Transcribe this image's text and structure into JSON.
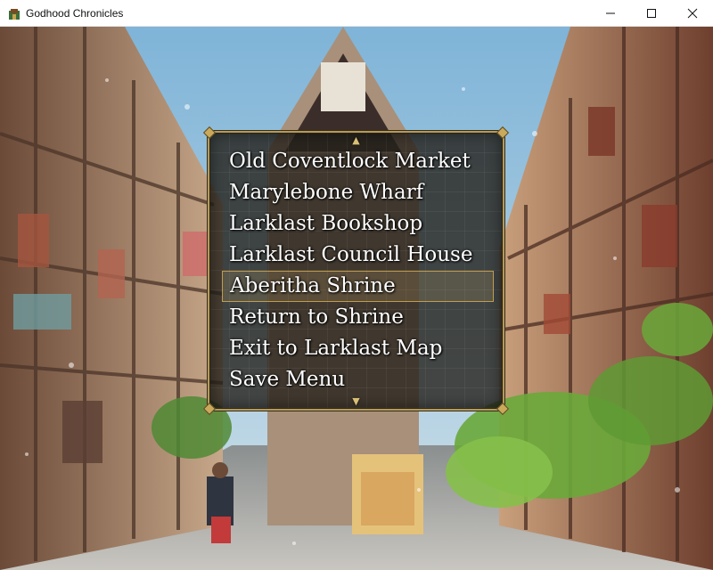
{
  "window": {
    "title": "Godhood Chronicles",
    "minimize_glyph": "—",
    "maximize_glyph": "☐",
    "close_glyph": "✕"
  },
  "menu": {
    "scroll_up_glyph": "▲",
    "scroll_down_glyph": "▼",
    "items": [
      "Old Coventlock Market",
      "Marylebone Wharf",
      "Larklast Bookshop",
      "Larklast Council House",
      "Aberitha Shrine",
      "Return to Shrine",
      "Exit to Larklast Map",
      "Save Menu"
    ],
    "selected_index": 4
  },
  "colors": {
    "menu_border": "#b49a5a",
    "menu_bg": "#26221c",
    "selection": "#d2aa50"
  }
}
